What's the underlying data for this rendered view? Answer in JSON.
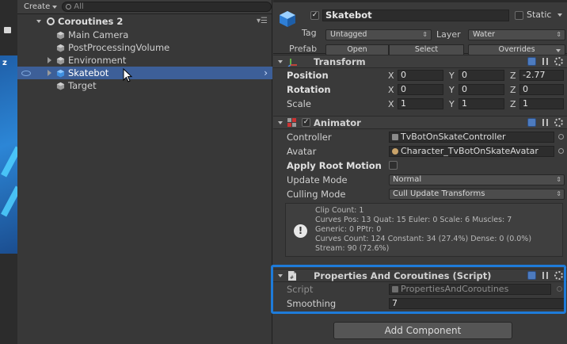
{
  "hierarchy": {
    "create_label": "Create",
    "search_placeholder": "All",
    "scene_name": "Coroutines 2",
    "items": [
      {
        "label": "Main Camera"
      },
      {
        "label": "PostProcessingVolume"
      },
      {
        "label": "Environment"
      },
      {
        "label": "Skatebot"
      },
      {
        "label": "Target"
      }
    ],
    "scene_sliver_letter": "z"
  },
  "inspector": {
    "object_name": "Skatebot",
    "static_label": "Static",
    "tag_label": "Tag",
    "tag_value": "Untagged",
    "layer_label": "Layer",
    "layer_value": "Water",
    "prefab_label": "Prefab",
    "prefab_open": "Open",
    "prefab_select": "Select",
    "prefab_overrides": "Overrides",
    "transform": {
      "title": "Transform",
      "position_label": "Position",
      "rotation_label": "Rotation",
      "scale_label": "Scale",
      "position": {
        "x": "0",
        "y": "0",
        "z": "-2.77"
      },
      "rotation": {
        "x": "0",
        "y": "0",
        "z": "0"
      },
      "scale": {
        "x": "1",
        "y": "1",
        "z": "1"
      },
      "axis_x": "X",
      "axis_y": "Y",
      "axis_z": "Z"
    },
    "animator": {
      "title": "Animator",
      "controller_label": "Controller",
      "controller_value": "TvBotOnSkateController",
      "avatar_label": "Avatar",
      "avatar_value": "Character_TvBotOnSkateAvatar",
      "apply_root_motion_label": "Apply Root Motion",
      "update_mode_label": "Update Mode",
      "update_mode_value": "Normal",
      "culling_mode_label": "Culling Mode",
      "culling_mode_value": "Cull Update Transforms",
      "info_lines": [
        "Clip Count: 1",
        "Curves Pos: 13 Quat: 15 Euler: 0 Scale: 6 Muscles: 7",
        "Generic: 0 PPtr: 0",
        "Curves Count: 124 Constant: 34 (27.4%) Dense: 0 (0.0%)",
        "Stream: 90 (72.6%)"
      ]
    },
    "script_component": {
      "title": "Properties And Coroutines (Script)",
      "script_label": "Script",
      "script_value": "PropertiesAndCoroutines",
      "smoothing_label": "Smoothing",
      "smoothing_value": "7"
    },
    "add_component_label": "Add Component"
  },
  "colors": {
    "selection": "#3d5f98",
    "highlight_outline": "#1e7bd9",
    "panel_bg": "#383838"
  }
}
